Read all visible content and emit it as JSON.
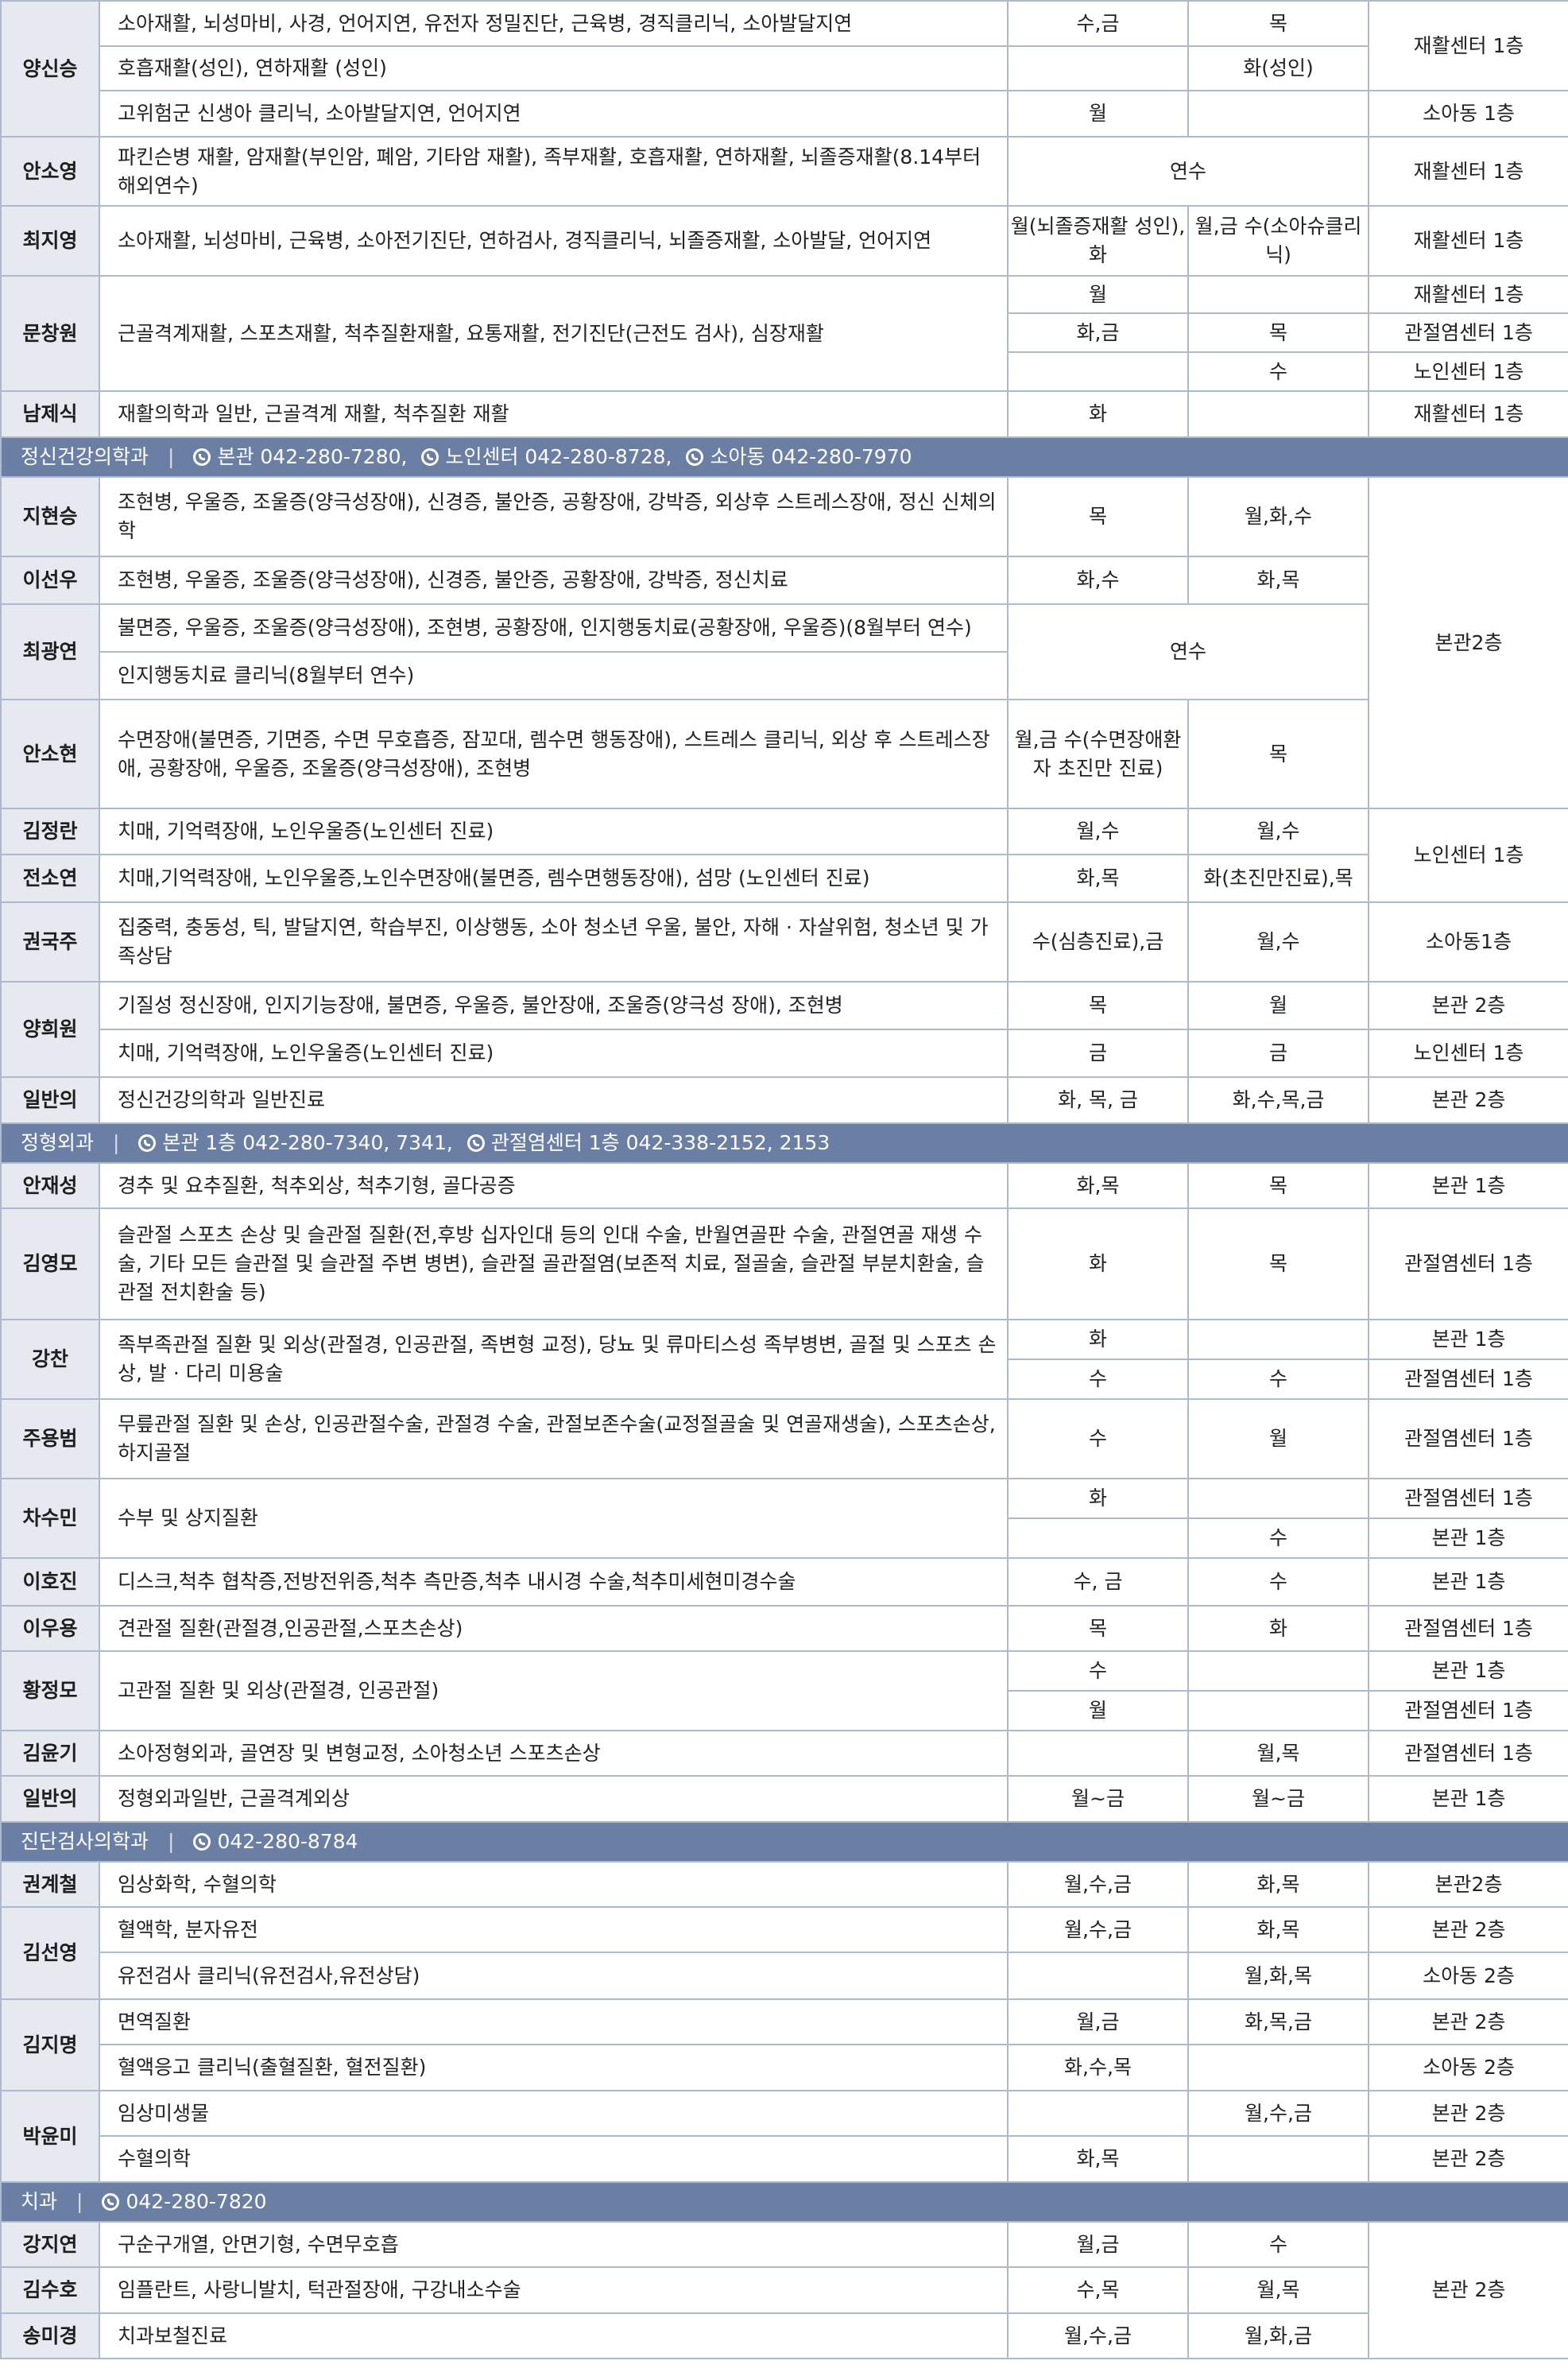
{
  "rows": [
    {
      "type": "data",
      "h": 57,
      "cells": [
        {
          "name": "양신승",
          "rowspan": 3,
          "n": 1
        },
        {
          "text": "소아재활, 뇌성마비, 사경, 언어지연,  유전자 정밀진단, 근육병, 경직클리닉, 소아발달지연",
          "n": 2
        },
        {
          "text": "수,금",
          "n": 3
        },
        {
          "text": "목",
          "n": 4
        },
        {
          "text": "재활센터 1층",
          "rowspan": 2,
          "n": 5
        }
      ]
    },
    {
      "type": "data",
      "h": 56,
      "cells": [
        {
          "text": "호흡재활(성인), 연하재활 (성인)",
          "n": 2
        },
        {
          "text": "",
          "n": 3
        },
        {
          "text": "화(성인)",
          "n": 4
        }
      ]
    },
    {
      "type": "data",
      "h": 58,
      "cells": [
        {
          "text": "고위험군 신생아 클리닉, 소아발달지연, 언어지연",
          "n": 2
        },
        {
          "text": "월",
          "n": 3
        },
        {
          "text": "",
          "n": 4
        },
        {
          "text": "소아동 1층",
          "n": 5
        }
      ]
    },
    {
      "type": "data",
      "h": 87,
      "cells": [
        {
          "name": "안소영",
          "n": 1
        },
        {
          "text": "파킨슨병 재활, 암재활(부인암, 폐암, 기타암 재활), 족부재활, 호흡재활, 연하재활, 뇌졸증재활(8.14부터 해외연수)",
          "n": 2
        },
        {
          "text": "연수",
          "colspan": 2,
          "n": 3
        },
        {
          "text": "재활센터 1층",
          "n": 5
        }
      ]
    },
    {
      "type": "data",
      "h": 88,
      "cells": [
        {
          "name": "최지영",
          "n": 1
        },
        {
          "text": "소아재활, 뇌성마비, 근육병, 소아전기진단, 연하검사, 경직클리닉, 뇌졸증재활, 소아발달, 언어지연",
          "n": 2
        },
        {
          "text": "월(뇌졸증재활 성인), 화",
          "n": 3
        },
        {
          "text": "월,금 수(소아슈클리닉)",
          "n": 4
        },
        {
          "text": "재활센터 1층",
          "n": 5
        }
      ]
    },
    {
      "type": "data",
      "h": 47,
      "cells": [
        {
          "name": "문창원",
          "rowspan": 3,
          "n": 1
        },
        {
          "text": "근골격계재활, 스포츠재활, 척추질환재활, 요통재활, 전기진단(근전도 검사), 심장재활",
          "rowspan": 3,
          "n": 2
        },
        {
          "text": "월",
          "n": 3
        },
        {
          "text": "",
          "n": 4
        },
        {
          "text": "재활센터 1층",
          "n": 5
        }
      ]
    },
    {
      "type": "data",
      "h": 49,
      "cells": [
        {
          "text": "화,금",
          "n": 3
        },
        {
          "text": "목",
          "n": 4
        },
        {
          "text": "관절염센터 1층",
          "n": 5
        }
      ]
    },
    {
      "type": "data",
      "h": 49,
      "cells": [
        {
          "text": "",
          "n": 3
        },
        {
          "text": "수",
          "n": 4
        },
        {
          "text": "노인센터 1층",
          "n": 5
        }
      ]
    },
    {
      "type": "data",
      "h": 58,
      "cells": [
        {
          "name": "남제식",
          "n": 1
        },
        {
          "text": "재활의학과 일반, 근골격계 재활, 척추질환 재활",
          "n": 2
        },
        {
          "text": "화",
          "n": 3
        },
        {
          "text": "",
          "n": 4
        },
        {
          "text": "재활센터 1층",
          "n": 5
        }
      ]
    },
    {
      "type": "section",
      "h": 50,
      "title": "정신건강의학과",
      "phones": [
        "본관 042-280-7280,",
        "노인센터 042-280-8728,",
        "소아동 042-280-7970"
      ]
    },
    {
      "type": "data",
      "h": 100,
      "cells": [
        {
          "name": "지현승",
          "n": 1
        },
        {
          "text": "조현병, 우울증, 조울증(양극성장애), 신경증, 불안증, 공황장애, 강박증, 외상후 스트레스장애, 정신 신체의학",
          "n": 2
        },
        {
          "text": "목",
          "n": 3
        },
        {
          "text": "월,화,수",
          "n": 4
        },
        {
          "text": "본관2층",
          "rowspan": 5,
          "n": 5
        }
      ]
    },
    {
      "type": "data",
      "h": 60,
      "cells": [
        {
          "name": "이선우",
          "n": 1
        },
        {
          "text": "조현병, 우울증, 조울증(양극성장애), 신경증, 불안증, 공황장애, 강박증, 정신치료",
          "n": 2
        },
        {
          "text": "화,수",
          "n": 3
        },
        {
          "text": "화,목",
          "n": 4
        }
      ]
    },
    {
      "type": "data",
      "h": 60,
      "cells": [
        {
          "name": "최광연",
          "rowspan": 2,
          "n": 1
        },
        {
          "text": "불면증, 우울증, 조울증(양극성장애), 조현병, 공황장애, 인지행동치료(공황장애, 우울증)(8월부터 연수)",
          "n": 2
        },
        {
          "text": "연수",
          "colspan": 2,
          "rowspan": 2,
          "n": 3
        }
      ]
    },
    {
      "type": "data",
      "h": 60,
      "cells": [
        {
          "text": "인지행동치료 클리닉(8월부터 연수)",
          "n": 2
        }
      ]
    },
    {
      "type": "data",
      "h": 137,
      "cells": [
        {
          "name": "안소현",
          "n": 1
        },
        {
          "text": "수면장애(불면증, 기면증, 수면 무호흡증, 잠꼬대, 렘수면 행동장애), 스트레스 클리닉, 외상 후 스트레스장애, 공황장애, 우울증, 조울증(양극성장애), 조현병",
          "n": 2
        },
        {
          "text": "월,금 수(수면장애환자 초진만 진료)",
          "n": 3
        },
        {
          "text": "목",
          "n": 4
        }
      ]
    },
    {
      "type": "data",
      "h": 58,
      "cells": [
        {
          "name": "김정란",
          "n": 1
        },
        {
          "text": "치매, 기억력장애, 노인우울증(노인센터 진료)",
          "n": 2
        },
        {
          "text": "월,수",
          "n": 3
        },
        {
          "text": "월,수",
          "n": 4
        },
        {
          "text": "노인센터 1층",
          "rowspan": 2,
          "n": 5
        }
      ]
    },
    {
      "type": "data",
      "h": 60,
      "cells": [
        {
          "name": "전소연",
          "n": 1
        },
        {
          "text": "치매,기억력장애, 노인우울증,노인수면장애(불면증, 렘수면행동장애), 섬망 (노인센터 진료)",
          "n": 2
        },
        {
          "text": "화,목",
          "n": 3
        },
        {
          "text": "화(초진만진료),목",
          "n": 4
        }
      ]
    },
    {
      "type": "data",
      "h": 100,
      "cells": [
        {
          "name": "권국주",
          "n": 1
        },
        {
          "text": "집중력, 충동성, 틱, 발달지연, 학습부진, 이상행동, 소아 청소년 우울, 불안, 자해 · 자살위험, 청소년 및 가족상담",
          "n": 2
        },
        {
          "text": "수(심층진료),금",
          "n": 3
        },
        {
          "text": "월,수",
          "n": 4
        },
        {
          "text": "소아동1층",
          "n": 5
        }
      ]
    },
    {
      "type": "data",
      "h": 60,
      "cells": [
        {
          "name": "양희원",
          "rowspan": 2,
          "n": 1
        },
        {
          "text": "기질성 정신장애, 인지기능장애, 불면증, 우울증, 불안장애, 조울증(양극성 장애), 조현병",
          "n": 2
        },
        {
          "text": "목",
          "n": 3
        },
        {
          "text": "월",
          "n": 4
        },
        {
          "text": "본관 2층",
          "n": 5
        }
      ]
    },
    {
      "type": "data",
      "h": 60,
      "cells": [
        {
          "text": "치매, 기억력장애, 노인우울증(노인센터 진료)",
          "n": 2
        },
        {
          "text": "금",
          "n": 3
        },
        {
          "text": "금",
          "n": 4
        },
        {
          "text": "노인센터 1층",
          "n": 5
        }
      ]
    },
    {
      "type": "data",
      "h": 58,
      "cells": [
        {
          "name": "일반의",
          "n": 1
        },
        {
          "text": "정신건강의학과 일반진료",
          "n": 2
        },
        {
          "text": "화, 목, 금",
          "n": 3
        },
        {
          "text": "화,수,목,금",
          "n": 4
        },
        {
          "text": "본관 2층",
          "n": 5
        }
      ]
    },
    {
      "type": "section",
      "h": 50,
      "title": "정형외과",
      "phones": [
        "본관 1층 042-280-7340, 7341,",
        "관절염센터 1층 042-338-2152, 2153"
      ]
    },
    {
      "type": "data",
      "h": 57,
      "cells": [
        {
          "name": "안재성",
          "n": 1
        },
        {
          "text": "경추 및 요추질환, 척추외상, 척추기형, 골다공증",
          "n": 2
        },
        {
          "text": "화,목",
          "n": 3
        },
        {
          "text": "목",
          "n": 4
        },
        {
          "text": "본관 1층",
          "n": 5
        }
      ]
    },
    {
      "type": "data",
      "h": 140,
      "cells": [
        {
          "name": "김영모",
          "n": 1
        },
        {
          "text": "슬관절 스포츠 손상 및 슬관절 질환(전,후방 십자인대 등의 인대 수술, 반월연골판 수술, 관절연골 재생 수술, 기타 모든 슬관절 및 슬관절 주변 병변), 슬관절 골관절염(보존적 치료, 절골술, 슬관절 부분치환술, 슬관절 전치환술 등)",
          "n": 2
        },
        {
          "text": "화",
          "n": 3
        },
        {
          "text": "목",
          "n": 4
        },
        {
          "text": "관절염센터 1층",
          "n": 5
        }
      ]
    },
    {
      "type": "data",
      "h": 50,
      "cells": [
        {
          "name": "강찬",
          "rowspan": 2,
          "n": 1
        },
        {
          "text": "족부족관절 질환 및 외상(관절경, 인공관절, 족변형 교정), 당뇨 및 류마티스성 족부병변, 골절 및 스포츠 손상, 발 · 다리 미용술",
          "rowspan": 2,
          "n": 2
        },
        {
          "text": "화",
          "n": 3
        },
        {
          "text": "",
          "n": 4
        },
        {
          "text": "본관 1층",
          "n": 5
        }
      ]
    },
    {
      "type": "data",
      "h": 50,
      "cells": [
        {
          "text": "수",
          "n": 3
        },
        {
          "text": "수",
          "n": 4
        },
        {
          "text": "관절염센터 1층",
          "n": 5
        }
      ]
    },
    {
      "type": "data",
      "h": 100,
      "cells": [
        {
          "name": "주용범",
          "n": 1
        },
        {
          "text": "무릎관절 질환 및 손상, 인공관절수술, 관절경 수술, 관절보존수술(교정절골술 및 연골재생술), 스포츠손상, 하지골절",
          "n": 2
        },
        {
          "text": "수",
          "n": 3
        },
        {
          "text": "월",
          "n": 4
        },
        {
          "text": "관절염센터 1층",
          "n": 5
        }
      ]
    },
    {
      "type": "data",
      "h": 50,
      "cells": [
        {
          "name": "차수민",
          "rowspan": 2,
          "n": 1
        },
        {
          "text": "수부 및 상지질환",
          "rowspan": 2,
          "n": 2
        },
        {
          "text": "화",
          "n": 3
        },
        {
          "text": "",
          "n": 4
        },
        {
          "text": "관절염센터 1층",
          "n": 5
        }
      ]
    },
    {
      "type": "data",
      "h": 50,
      "cells": [
        {
          "text": "",
          "n": 3
        },
        {
          "text": "수",
          "n": 4
        },
        {
          "text": "본관 1층",
          "n": 5
        }
      ]
    },
    {
      "type": "data",
      "h": 60,
      "cells": [
        {
          "name": "이호진",
          "n": 1
        },
        {
          "text": "디스크,척추 협착증,전방전위증,척추 측만증,척추 내시경 수술,척추미세현미경수술",
          "n": 2
        },
        {
          "text": "수, 금",
          "n": 3
        },
        {
          "text": "수",
          "n": 4
        },
        {
          "text": "본관 1층",
          "n": 5
        }
      ]
    },
    {
      "type": "data",
      "h": 57,
      "cells": [
        {
          "name": "이우용",
          "n": 1
        },
        {
          "text": "견관절 질환(관절경,인공관절,스포츠손상)",
          "n": 2
        },
        {
          "text": "목",
          "n": 3
        },
        {
          "text": "화",
          "n": 4
        },
        {
          "text": "관절염센터 1층",
          "n": 5
        }
      ]
    },
    {
      "type": "data",
      "h": 50,
      "cells": [
        {
          "name": "황정모",
          "rowspan": 2,
          "n": 1
        },
        {
          "text": "고관절 질환 및 외상(관절경, 인공관절)",
          "rowspan": 2,
          "n": 2
        },
        {
          "text": "수",
          "n": 3
        },
        {
          "text": "",
          "n": 4
        },
        {
          "text": "본관 1층",
          "n": 5
        }
      ]
    },
    {
      "type": "data",
      "h": 50,
      "cells": [
        {
          "text": "월",
          "n": 3
        },
        {
          "text": "",
          "n": 4
        },
        {
          "text": "관절염센터 1층",
          "n": 5
        }
      ]
    },
    {
      "type": "data",
      "h": 57,
      "cells": [
        {
          "name": "김윤기",
          "n": 1
        },
        {
          "text": "소아정형외과, 골연장 및 변형교정, 소아청소년 스포츠손상",
          "n": 2
        },
        {
          "text": "",
          "n": 3
        },
        {
          "text": "월,목",
          "n": 4
        },
        {
          "text": "관절염센터 1층",
          "n": 5
        }
      ]
    },
    {
      "type": "data",
      "h": 58,
      "cells": [
        {
          "name": "일반의",
          "n": 1
        },
        {
          "text": "정형외과일반, 근골격계외상",
          "n": 2
        },
        {
          "text": "월~금",
          "n": 3
        },
        {
          "text": "월~금",
          "n": 4
        },
        {
          "text": "본관 1층",
          "n": 5
        }
      ]
    },
    {
      "type": "section",
      "h": 50,
      "title": "진단검사의학과",
      "phones": [
        "042-280-8784"
      ]
    },
    {
      "type": "data",
      "h": 57,
      "cells": [
        {
          "name": "권계철",
          "n": 1
        },
        {
          "text": "임상화학, 수혈의학",
          "n": 2
        },
        {
          "text": "월,수,금",
          "n": 3
        },
        {
          "text": "화,목",
          "n": 4
        },
        {
          "text": "본관2층",
          "n": 5
        }
      ]
    },
    {
      "type": "data",
      "h": 57,
      "cells": [
        {
          "name": "김선영",
          "rowspan": 2,
          "n": 1
        },
        {
          "text": "혈액학, 분자유전",
          "n": 2
        },
        {
          "text": "월,수,금",
          "n": 3
        },
        {
          "text": "화,목",
          "n": 4
        },
        {
          "text": "본관 2층",
          "n": 5
        }
      ]
    },
    {
      "type": "data",
      "h": 59,
      "cells": [
        {
          "text": "유전검사 클리닉(유전검사,유전상담)",
          "n": 2
        },
        {
          "text": "",
          "n": 3
        },
        {
          "text": "월,화,목",
          "n": 4
        },
        {
          "text": "소아동 2층",
          "n": 5
        }
      ]
    },
    {
      "type": "data",
      "h": 57,
      "cells": [
        {
          "name": "김지명",
          "rowspan": 2,
          "n": 1
        },
        {
          "text": "면역질환",
          "n": 2
        },
        {
          "text": "월,금",
          "n": 3
        },
        {
          "text": "화,목,금",
          "n": 4
        },
        {
          "text": "본관 2층",
          "n": 5
        }
      ]
    },
    {
      "type": "data",
      "h": 58,
      "cells": [
        {
          "text": "혈액응고 클리닉(출혈질환, 혈전질환)",
          "n": 2
        },
        {
          "text": "화,수,목",
          "n": 3
        },
        {
          "text": "",
          "n": 4
        },
        {
          "text": "소아동 2층",
          "n": 5
        }
      ]
    },
    {
      "type": "data",
      "h": 57,
      "cells": [
        {
          "name": "박윤미",
          "rowspan": 2,
          "n": 1
        },
        {
          "text": "임상미생물",
          "n": 2
        },
        {
          "text": "",
          "n": 3
        },
        {
          "text": "월,수,금",
          "n": 4
        },
        {
          "text": "본관 2층",
          "n": 5
        }
      ]
    },
    {
      "type": "data",
      "h": 58,
      "cells": [
        {
          "text": "수혈의학",
          "n": 2
        },
        {
          "text": "화,목",
          "n": 3
        },
        {
          "text": "",
          "n": 4
        },
        {
          "text": "본관 2층",
          "n": 5
        }
      ]
    },
    {
      "type": "section",
      "h": 50,
      "title": "치과",
      "phones": [
        "042-280-7820"
      ]
    },
    {
      "type": "data",
      "h": 57,
      "cells": [
        {
          "name": "강지연",
          "n": 1
        },
        {
          "text": "구순구개열, 안면기형, 수면무호흡",
          "n": 2
        },
        {
          "text": "월,금",
          "n": 3
        },
        {
          "text": "수",
          "n": 4
        },
        {
          "text": "본관 2층",
          "rowspan": 3,
          "n": 5
        }
      ]
    },
    {
      "type": "data",
      "h": 58,
      "cells": [
        {
          "name": "김수호",
          "n": 1
        },
        {
          "text": "임플란트, 사랑니발치, 턱관절장애, 구강내소수술",
          "n": 2
        },
        {
          "text": "수,목",
          "n": 3
        },
        {
          "text": "월,목",
          "n": 4
        }
      ]
    },
    {
      "type": "data",
      "h": 57,
      "cells": [
        {
          "name": "송미경",
          "n": 1
        },
        {
          "text": "치과보철진료",
          "n": 2
        },
        {
          "text": "월,수,금",
          "n": 3
        },
        {
          "text": "월,화,금",
          "n": 4
        }
      ]
    }
  ]
}
